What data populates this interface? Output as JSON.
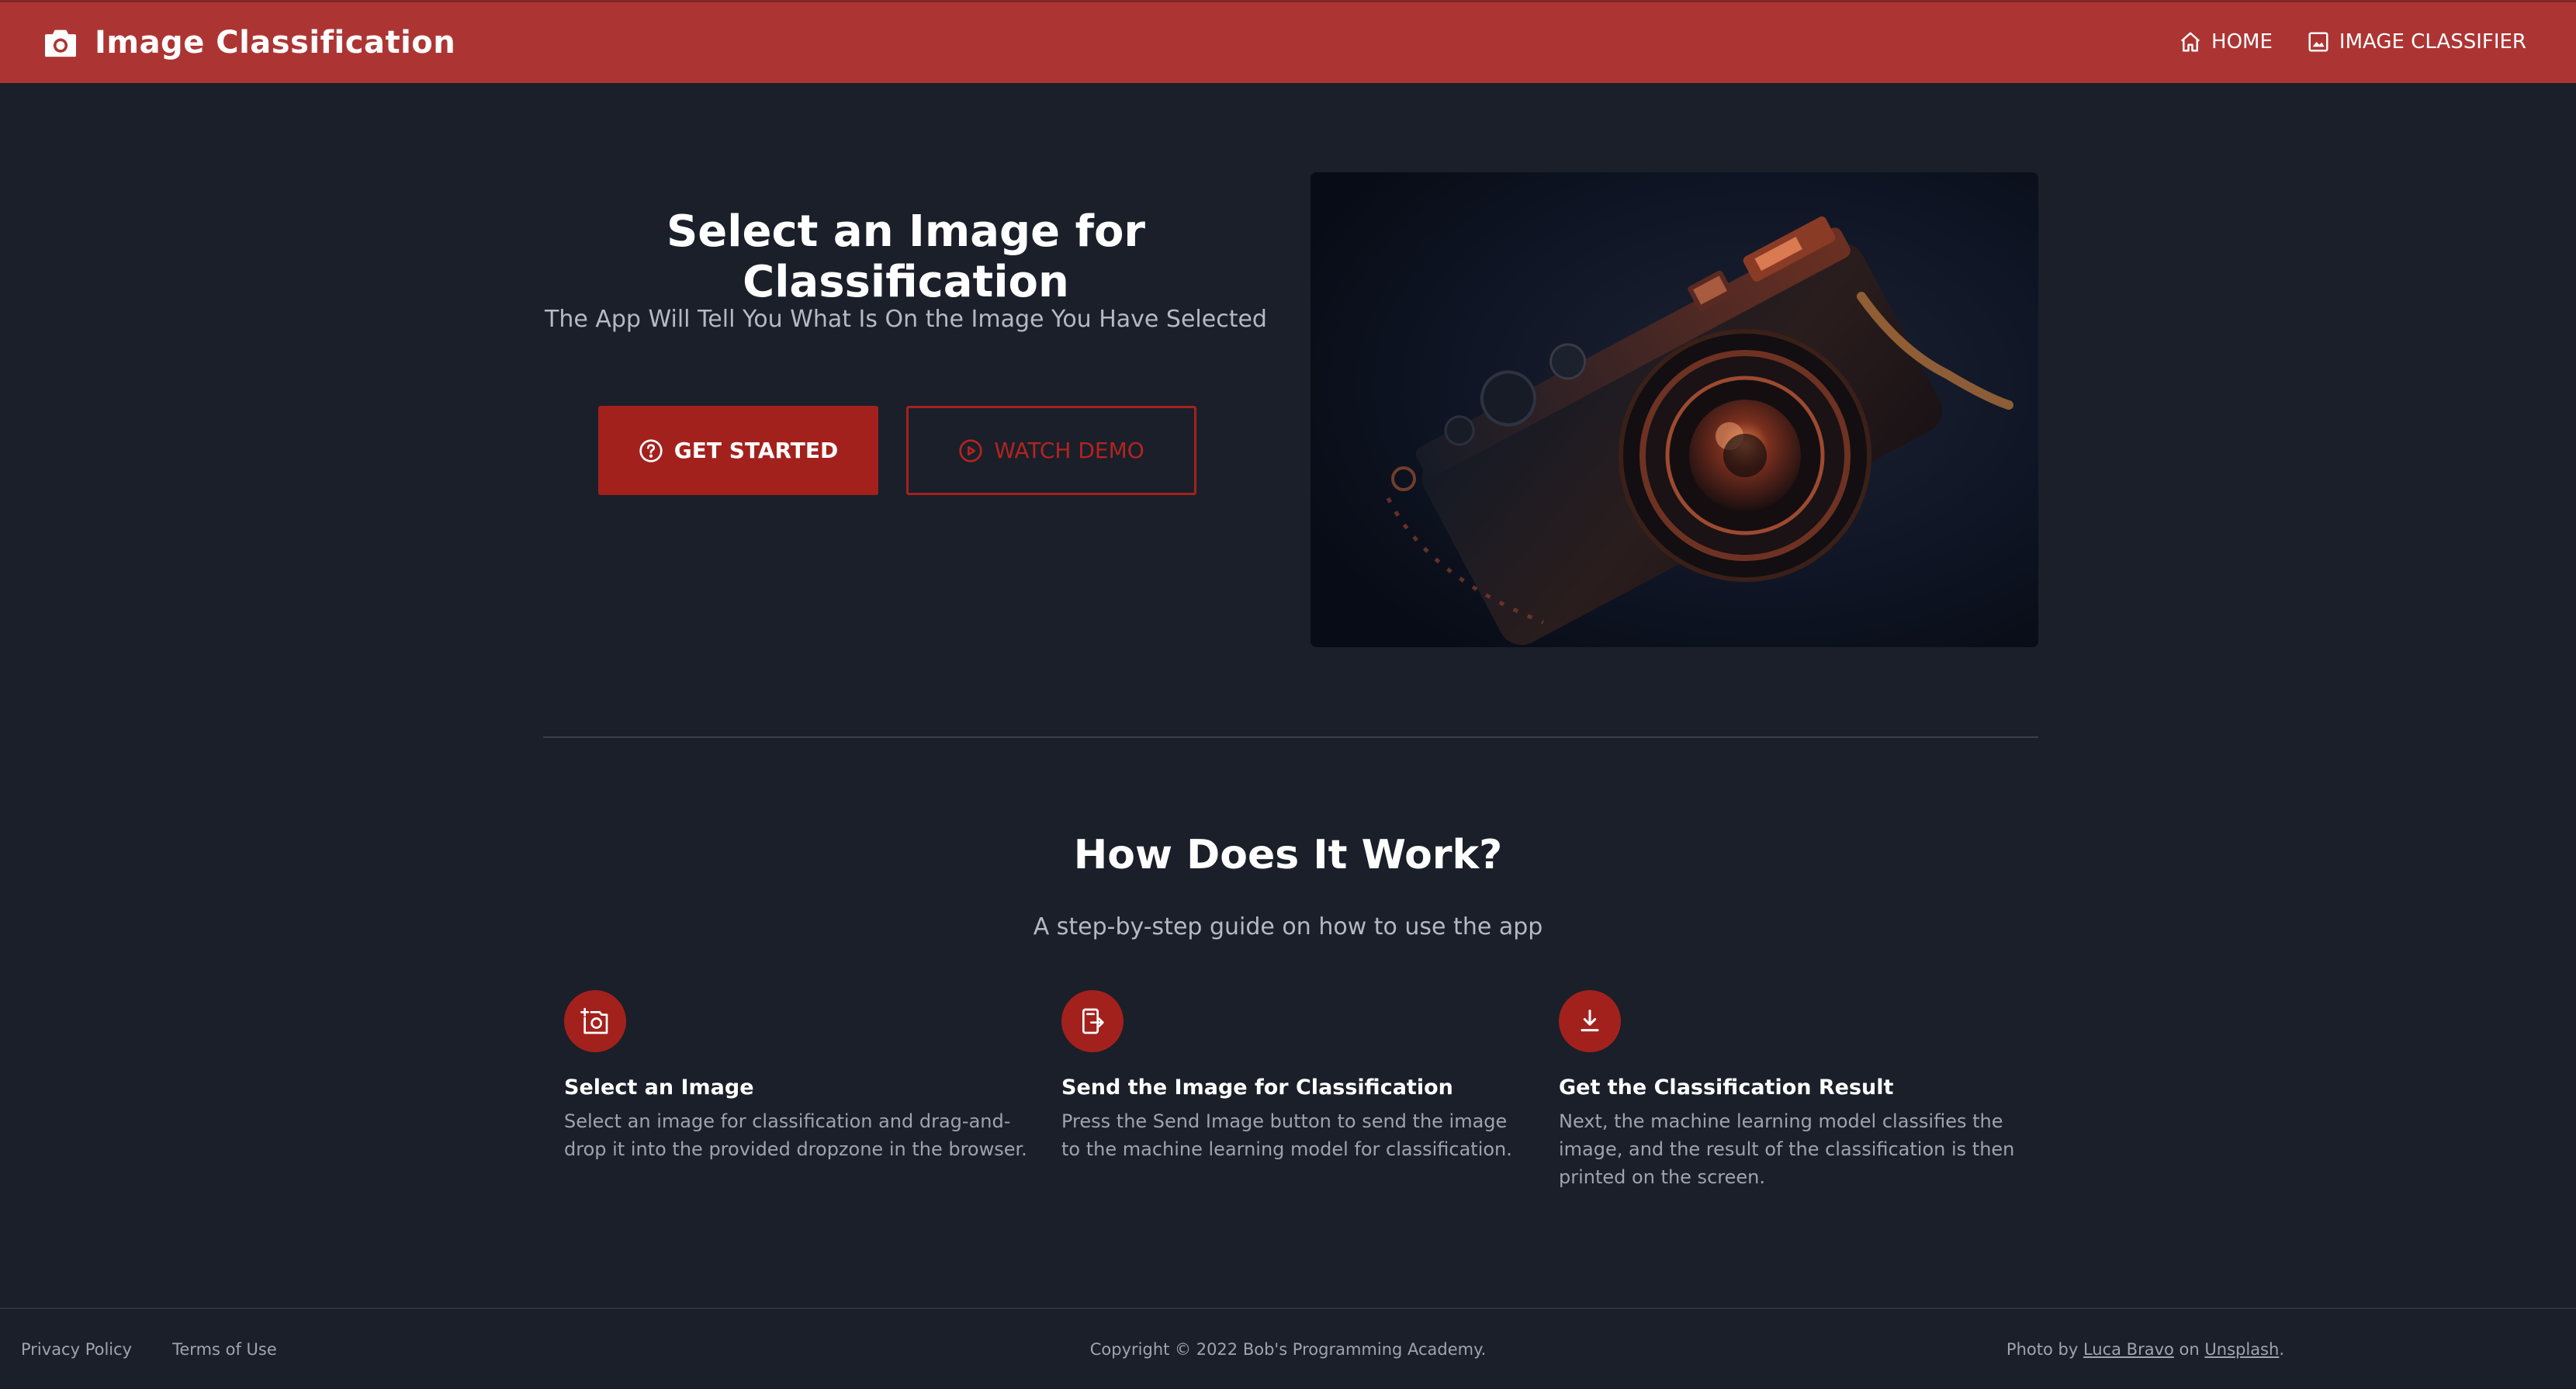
{
  "navbar": {
    "brand_icon": "camera-icon",
    "brand_title": "Image Classification",
    "links": [
      {
        "icon": "home-icon",
        "label": "HOME"
      },
      {
        "icon": "image-icon",
        "label": "IMAGE CLASSIFIER"
      }
    ],
    "background_color": "#ac3533"
  },
  "hero": {
    "title": "Select an Image for Classification",
    "subtitle": "The App Will Tell You What Is On the Image You Have Selected",
    "primary_button": {
      "icon": "question-circle-icon",
      "label": "GET STARTED"
    },
    "secondary_button": {
      "icon": "play-circle-icon",
      "label": "WATCH DEMO"
    },
    "image": "camera-photo"
  },
  "how_it_works": {
    "title": "How Does It Work?",
    "subtitle": "A step-by-step guide on how to use the app",
    "steps": [
      {
        "icon": "add-photo-icon",
        "title": "Select an Image",
        "description": "Select an image for classification and drag-and-drop it into the provided dropzone in the browser."
      },
      {
        "icon": "send-device-icon",
        "title": "Send the Image for Classification",
        "description": "Press the Send Image button to send the image to the machine learning model for classification."
      },
      {
        "icon": "download-icon",
        "title": "Get the Classification Result",
        "description": "Next, the machine learning model classifies the image, and the result of the classification is then printed on the screen."
      }
    ]
  },
  "footer": {
    "privacy_label": "Privacy Policy",
    "terms_label": "Terms of Use",
    "copyright": "Copyright © 2022 Bob's Programming Academy.",
    "photo_credit": {
      "prefix": "Photo by",
      "author": "Luca Bravo",
      "joiner": "on",
      "source": "Unsplash",
      "suffix": "."
    }
  },
  "colors": {
    "accent": "#a3211d",
    "background": "#1a1f29",
    "muted_text": "#9ea4ae"
  }
}
